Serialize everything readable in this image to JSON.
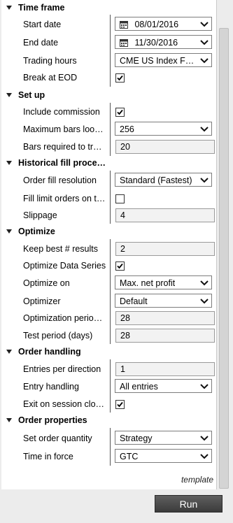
{
  "sections": {
    "time_frame": {
      "title": "Time frame",
      "start_date": {
        "label": "Start date",
        "value": "08/01/2016",
        "icon": "calendar-icon"
      },
      "end_date": {
        "label": "End date",
        "value": "11/30/2016",
        "icon": "calendar-icon"
      },
      "trading_hours": {
        "label": "Trading hours",
        "value": "CME US Index Fut…"
      },
      "break_at_eod": {
        "label": "Break at EOD",
        "checked": true
      }
    },
    "set_up": {
      "title": "Set up",
      "include_commission": {
        "label": "Include commission",
        "checked": true
      },
      "max_bars": {
        "label": "Maximum bars loo…",
        "value": "256"
      },
      "bars_required": {
        "label": "Bars required to tr…",
        "value": "20"
      }
    },
    "historical_fill": {
      "title": "Historical fill proce…",
      "order_fill_resolution": {
        "label": "Order fill resolution",
        "value": "Standard (Fastest)"
      },
      "fill_limit_orders": {
        "label": "Fill limit orders on t…",
        "checked": false
      },
      "slippage": {
        "label": "Slippage",
        "value": "4"
      }
    },
    "optimize": {
      "title": "Optimize",
      "keep_best": {
        "label": "Keep best # results",
        "value": "2"
      },
      "optimize_data_series": {
        "label": "Optimize Data Series",
        "checked": true
      },
      "optimize_on": {
        "label": "Optimize on",
        "value": "Max. net profit"
      },
      "optimizer": {
        "label": "Optimizer",
        "value": "Default"
      },
      "optimization_period": {
        "label": "Optimization perio…",
        "value": "28"
      },
      "test_period": {
        "label": "Test period (days)",
        "value": "28"
      }
    },
    "order_handling": {
      "title": "Order handling",
      "entries_per_direction": {
        "label": "Entries per direction",
        "value": "1"
      },
      "entry_handling": {
        "label": "Entry handling",
        "value": "All entries"
      },
      "exit_on_session_close": {
        "label": "Exit on session clo…",
        "checked": true
      }
    },
    "order_properties": {
      "title": "Order properties",
      "set_order_quantity": {
        "label": "Set order quantity",
        "value": "Strategy"
      },
      "time_in_force": {
        "label": "Time in force",
        "value": "GTC"
      }
    }
  },
  "footer": {
    "template_label": "template",
    "run_label": "Run"
  },
  "colors": {
    "run_button_bg": "#4a4a4a",
    "panel_bg": "#ffffff",
    "window_bg": "#ececec"
  }
}
